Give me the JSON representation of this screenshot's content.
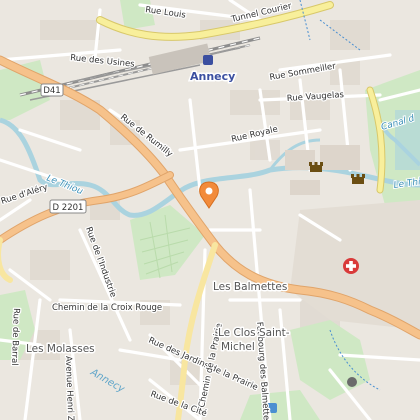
{
  "map": {
    "city_label": "Annecy",
    "streets": {
      "rue_louis": "Rue Louis",
      "tunnel_courier": "Tunnel Courier",
      "rue_des_usines": "Rue des Usines",
      "rue_sommeiller": "Rue Sommeiller",
      "rue_vaugelas": "Rue Vaugelas",
      "rue_de_rumilly": "Rue de Rumilly",
      "rue_royale": "Rue Royale",
      "rue_d_alery": "Rue d'Aléry",
      "rue_de_l_industrie": "Rue de l'Industrie",
      "chemin_croix_rouge": "Chemin de la Croix Rouge",
      "rue_de_barral": "Rue de Barral",
      "avenue_henri": "Avenue Henri Z",
      "rue_des_jardins": "Rue des Jardins de la Prairie",
      "chemin_de_la_prairie": "Chemin de la Prairie",
      "faubourg_des_balmettes": "Faubourg des Balmettes",
      "rue_de_la_cite": "Rue de la Cité"
    },
    "road_shields": {
      "d41": "D41",
      "d2201": "D 2201"
    },
    "waterways": {
      "le_thiou": "Le Thiou",
      "le_thiou_right": "Le Thio",
      "canal": "Canal d"
    },
    "areas": {
      "les_balmettes": "Les Balmettes",
      "le_clos_saint_michel_1": "Le Clos Saint-",
      "le_clos_saint_michel_2": "Michel",
      "les_molasses": "Les Molasses",
      "annecy_faint": "Annecy"
    },
    "markers": {
      "selected_pin": "location-pin",
      "hospital": "hospital-cross",
      "castle_1": "castle",
      "castle_2": "castle"
    },
    "colors": {
      "background": "#ece8e2",
      "major_road": "#f6c28b",
      "tunnel_road": "#f8ef9b",
      "water": "#aad3df",
      "park": "#cfe8c4",
      "rail": "#8d8d8d",
      "pin": "#f28b3b",
      "hospital": "#d93a3a"
    }
  }
}
